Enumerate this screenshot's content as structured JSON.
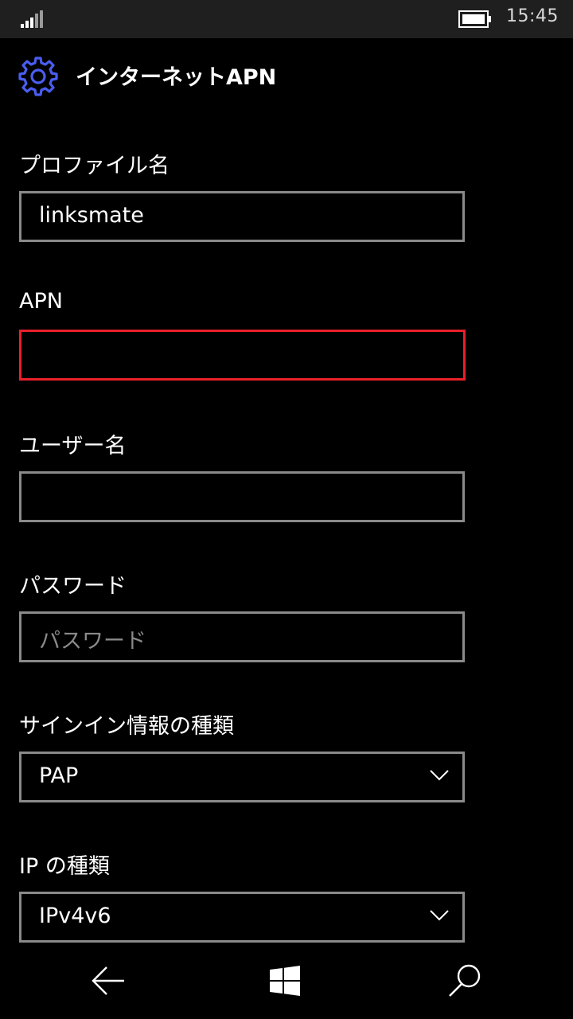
{
  "status_bar": {
    "time": "15:45",
    "icons": [
      "signal-strength-icon",
      "battery-icon"
    ]
  },
  "header": {
    "title": "インターネットAPN",
    "icon": "gear-icon",
    "accent_color": "#4a5df0"
  },
  "form": {
    "profile_name": {
      "label": "プロファイル名",
      "value": "linksmate"
    },
    "apn": {
      "label": "APN",
      "value": "",
      "border_color": "#e8202a"
    },
    "username": {
      "label": "ユーザー名",
      "value": ""
    },
    "password": {
      "label": "パスワード",
      "placeholder": "パスワード"
    },
    "sign_in_type": {
      "label": "サインイン情報の種類",
      "selected": "PAP"
    },
    "ip_type": {
      "label": "IP の種類",
      "selected": "IPv4v6"
    }
  },
  "nav_bar": {
    "icons": [
      "back-arrow-icon",
      "windows-start-icon",
      "search-icon"
    ]
  }
}
